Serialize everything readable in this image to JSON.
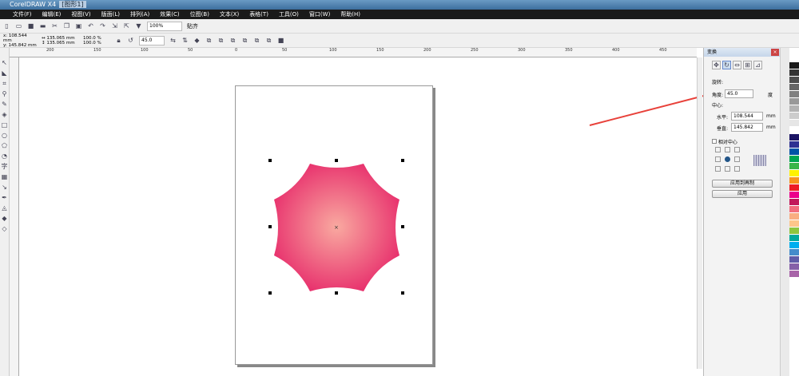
{
  "app": {
    "title": "CorelDRAW X4",
    "document": "[图形1]"
  },
  "menu": [
    "文件(F)",
    "编辑(E)",
    "视图(V)",
    "版面(L)",
    "排列(A)",
    "效果(C)",
    "位图(B)",
    "文本(X)",
    "表格(T)",
    "工具(O)",
    "窗口(W)",
    "帮助(H)"
  ],
  "toolbar": {
    "zoom": "100%",
    "snap": "贴齐"
  },
  "property_bar": {
    "x": "108.544 mm",
    "y": "145.842 mm",
    "width": "135.065 mm",
    "height": "135.065 mm",
    "scale_x": "100.0",
    "scale_y": "100.0",
    "percent": "%",
    "rotation": "45.0"
  },
  "ruler": {
    "ticks": [
      "200",
      "150",
      "100",
      "50",
      "0",
      "50",
      "100",
      "150",
      "200",
      "250",
      "300",
      "350",
      "400",
      "450"
    ]
  },
  "docker": {
    "title": "变换",
    "section": "旋转:",
    "angle_label": "角度:",
    "angle": "45.0",
    "angle_unit": "度",
    "center_label": "中心:",
    "h_label": "水平:",
    "h_value": "108.544",
    "v_label": "垂直:",
    "v_value": "145.842",
    "unit": "mm",
    "relative_center": "相对中心",
    "apply_duplicate": "应用到再制",
    "apply": "应用"
  },
  "shape": {
    "fill_center": "#f9a9a0",
    "fill_edge": "#e8336e"
  },
  "annotation": {
    "arrow_color": "#e8413a"
  },
  "palette": [
    "#1a1a1a",
    "#333",
    "#4d4d4d",
    "#666",
    "#808080",
    "#999",
    "#b3b3b3",
    "#ccc",
    "#e6e6e6",
    "#fff",
    "#1b1464",
    "#2e3192",
    "#0054a6",
    "#00a651",
    "#39b54a",
    "#fff200",
    "#f7941d",
    "#ed1c24",
    "#ec008c",
    "#c2185b",
    "#f26d7d",
    "#f9ad81",
    "#fdc68a",
    "#8dc63f",
    "#00a99d",
    "#00aeef",
    "#448ccb",
    "#605ca8",
    "#8560a8",
    "#a864a8"
  ]
}
